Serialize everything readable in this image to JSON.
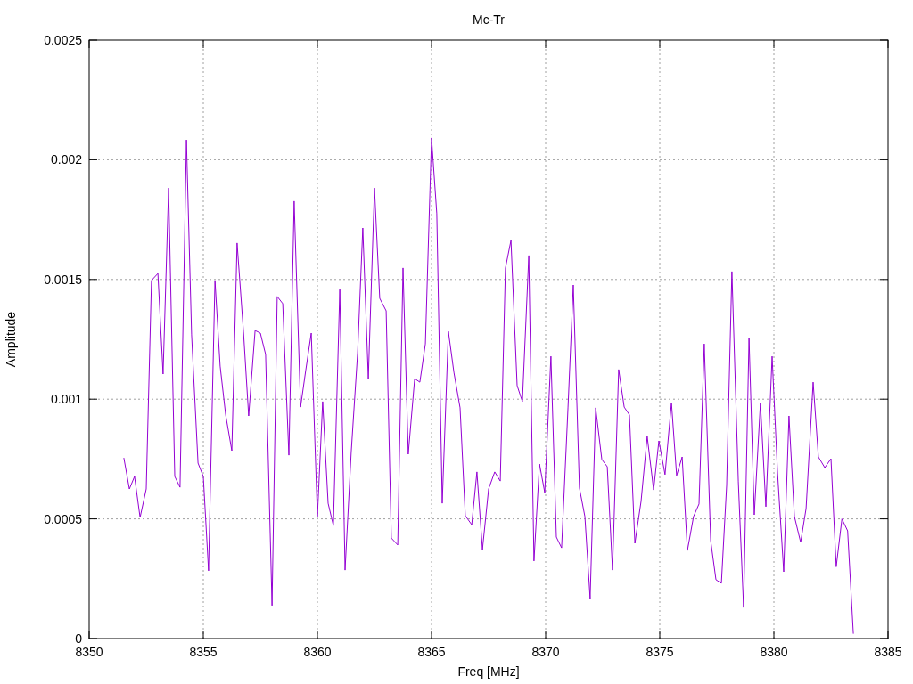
{
  "chart": {
    "chart_data": {
      "type": "line",
      "title": "Mc-Tr",
      "xlabel": "Freq [MHz]",
      "ylabel": "Amplitude",
      "grid": true,
      "xlim": [
        8350,
        8385
      ],
      "ylim": [
        0,
        0.0025
      ],
      "xticks": [
        8350,
        8355,
        8360,
        8365,
        8370,
        8375,
        8380,
        8385
      ],
      "yticks": [
        0,
        0.0005,
        0.001,
        0.0015,
        0.002,
        0.0025
      ],
      "x": [
        8351.52,
        8351.76,
        8351.99,
        8352.23,
        8352.5,
        8352.73,
        8353.01,
        8353.24,
        8353.48,
        8353.75,
        8353.98,
        8354.26,
        8354.49,
        8354.77,
        8355.0,
        8355.23,
        8355.51,
        8355.74,
        8355.98,
        8356.25,
        8356.48,
        8356.76,
        8356.99,
        8357.27,
        8357.5,
        8357.73,
        8358.01,
        8358.24,
        8358.48,
        8358.75,
        8358.98,
        8359.26,
        8359.49,
        8359.73,
        8360.0,
        8360.23,
        8360.47,
        8360.7,
        8360.98,
        8361.21,
        8361.48,
        8361.76,
        8361.99,
        8362.23,
        8362.5,
        8362.73,
        8363.01,
        8363.24,
        8363.52,
        8363.75,
        8363.98,
        8364.26,
        8364.49,
        8364.73,
        8365.0,
        8365.23,
        8365.47,
        8365.74,
        8365.98,
        8366.25,
        8366.48,
        8366.76,
        8366.99,
        8367.23,
        8367.5,
        8367.77,
        8368.01,
        8368.24,
        8368.48,
        8368.75,
        8368.98,
        8369.26,
        8369.49,
        8369.73,
        8369.96,
        8370.23,
        8370.47,
        8370.7,
        8370.98,
        8371.21,
        8371.48,
        8371.72,
        8371.95,
        8372.19,
        8372.46,
        8372.7,
        8372.93,
        8373.2,
        8373.44,
        8373.67,
        8373.91,
        8374.18,
        8374.45,
        8374.73,
        8374.96,
        8375.23,
        8375.51,
        8375.74,
        8375.98,
        8376.21,
        8376.48,
        8376.72,
        8376.95,
        8377.23,
        8377.46,
        8377.7,
        8377.93,
        8378.16,
        8378.44,
        8378.67,
        8378.91,
        8379.14,
        8379.41,
        8379.65,
        8379.92,
        8380.16,
        8380.43,
        8380.66,
        8380.9,
        8381.17,
        8381.41,
        8381.72,
        8381.95,
        8382.23,
        8382.5,
        8382.73,
        8382.98,
        8383.23,
        8383.48
      ],
      "series": [
        {
          "color": "#9400d3",
          "values": [
            0.000755,
            0.000625,
            0.000677,
            0.000506,
            0.000625,
            0.001496,
            0.001525,
            0.001105,
            0.001882,
            0.000677,
            0.000632,
            0.002083,
            0.001269,
            0.000733,
            0.000677,
            0.000283,
            0.001496,
            0.001138,
            0.000934,
            0.000785,
            0.001652,
            0.00128,
            0.00093,
            0.001287,
            0.001276,
            0.001187,
            0.000138,
            0.001429,
            0.001399,
            0.000766,
            0.001827,
            0.000967,
            0.00112,
            0.001276,
            0.00051,
            0.00099,
            0.000565,
            0.000472,
            0.001458,
            0.000286,
            0.000778,
            0.001194,
            0.001715,
            0.001086,
            0.001882,
            0.001421,
            0.001369,
            0.00042,
            0.000391,
            0.001548,
            0.00077,
            0.001086,
            0.001071,
            0.001231,
            0.002091,
            0.001775,
            0.000565,
            0.001283,
            0.001112,
            0.000964,
            0.000513,
            0.000476,
            0.000696,
            0.000372,
            0.000625,
            0.000696,
            0.000658,
            0.001548,
            0.001663,
            0.001057,
            0.00099,
            0.0016,
            0.000324,
            0.000729,
            0.00061,
            0.001179,
            0.000424,
            0.000379,
            0.000967,
            0.001477,
            0.000629,
            0.00051,
            0.000167,
            0.000964,
            0.000748,
            0.000718,
            0.000286,
            0.001124,
            0.000967,
            0.000934,
            0.000398,
            0.000573,
            0.000845,
            0.000621,
            0.000826,
            0.000685,
            0.000986,
            0.000681,
            0.000759,
            0.000368,
            0.00051,
            0.000562,
            0.001231,
            0.000409,
            0.000246,
            0.000231,
            0.00064,
            0.001533,
            0.000655,
            0.00013,
            0.001257,
            0.000517,
            0.000986,
            0.000551,
            0.001179,
            0.000692,
            0.000279,
            0.00093,
            0.00051,
            0.000402,
            0.000543,
            0.001071,
            0.000759,
            0.000714,
            0.000751,
            0.0003,
            0.0005,
            0.00045,
            2e-05
          ]
        }
      ]
    }
  }
}
